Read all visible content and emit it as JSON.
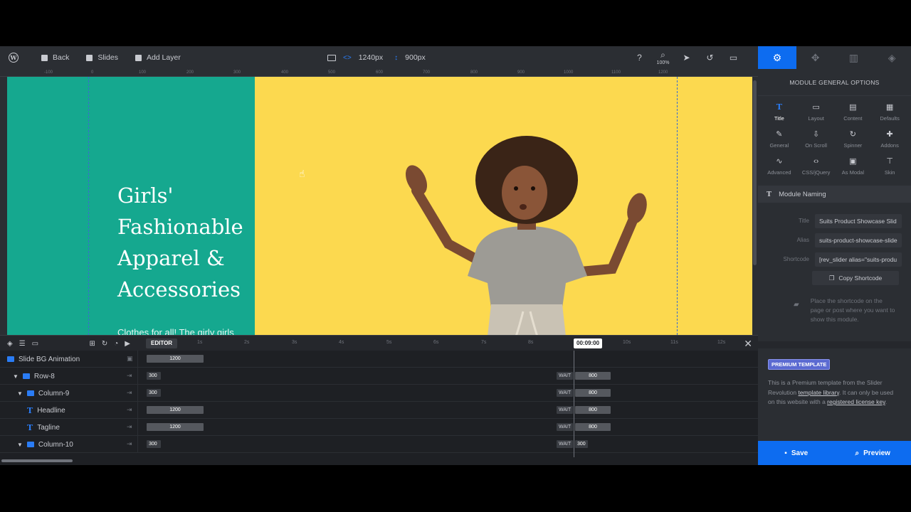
{
  "toolbar": {
    "back_label": "Back",
    "slides_label": "Slides",
    "add_layer_label": "Add Layer",
    "width_value": "1240px",
    "height_value": "900px",
    "zoom_value": "100%"
  },
  "ruler": {
    "labels": [
      "-100",
      "0",
      "100",
      "200",
      "300",
      "400",
      "500",
      "600",
      "700",
      "800",
      "900",
      "1000",
      "1100",
      "1200"
    ]
  },
  "canvas": {
    "headline": "Girls' Fashionable Apparel & Accessories",
    "tagline": "Clothes for all! The girly girls",
    "colors": {
      "left_column": "#15a88f",
      "background": "#fcd94f"
    }
  },
  "timeline": {
    "editor_label": "EDITOR",
    "time_marker": "00:09:00",
    "ticks": [
      "1s",
      "2s",
      "3s",
      "4s",
      "5s",
      "6s",
      "7s",
      "8s",
      "9s",
      "10s",
      "11s",
      "12s"
    ],
    "rows": [
      {
        "name": "Slide BG Animation",
        "bar": "1200",
        "wait": "",
        "end": ""
      },
      {
        "name": "Row-8",
        "bar": "300",
        "wait": "WAIT",
        "end": "800"
      },
      {
        "name": "Column-9",
        "bar": "300",
        "wait": "WAIT",
        "end": "800"
      },
      {
        "name": "Headline",
        "bar": "1200",
        "wait": "WAIT",
        "end": "800"
      },
      {
        "name": "Tagline",
        "bar": "1200",
        "wait": "WAIT",
        "end": "800"
      },
      {
        "name": "Column-10",
        "bar": "300",
        "wait": "WAIT",
        "end": "300"
      }
    ]
  },
  "panel": {
    "title": "MODULE GENERAL OPTIONS",
    "options": [
      {
        "label": "Title",
        "icon": "T"
      },
      {
        "label": "Layout",
        "icon": "▭"
      },
      {
        "label": "Content",
        "icon": "▤"
      },
      {
        "label": "Defaults",
        "icon": "▦"
      },
      {
        "label": "General",
        "icon": "✎"
      },
      {
        "label": "On Scroll",
        "icon": "⇩"
      },
      {
        "label": "Spinner",
        "icon": "↻"
      },
      {
        "label": "Addons",
        "icon": "✚"
      },
      {
        "label": "Advanced",
        "icon": "∿"
      },
      {
        "label": "CSS/jQuery",
        "icon": "‹›"
      },
      {
        "label": "As Modal",
        "icon": "▣"
      },
      {
        "label": "Skin",
        "icon": "⊤"
      }
    ],
    "section_title": "Module Naming",
    "title_label": "Title",
    "title_value": "Suits Product Showcase Slid",
    "alias_label": "Alias",
    "alias_value": "suits-product-showcase-slide",
    "shortcode_label": "Shortcode",
    "shortcode_value": "[rev_slider alias=\"suits-produ",
    "copy_label": "Copy Shortcode",
    "hint": "Place the shortcode on the page or post where you want to show this module.",
    "premium_badge": "PREMIUM TEMPLATE",
    "premium_text_1": "This is a Premium template from the Slider Revolution ",
    "premium_link_1": "template library",
    "premium_text_2": ". It can only be used on this website with a ",
    "premium_link_2": "registered license key",
    "premium_text_3": "."
  },
  "footer": {
    "save_label": "Save",
    "preview_label": "Preview"
  }
}
